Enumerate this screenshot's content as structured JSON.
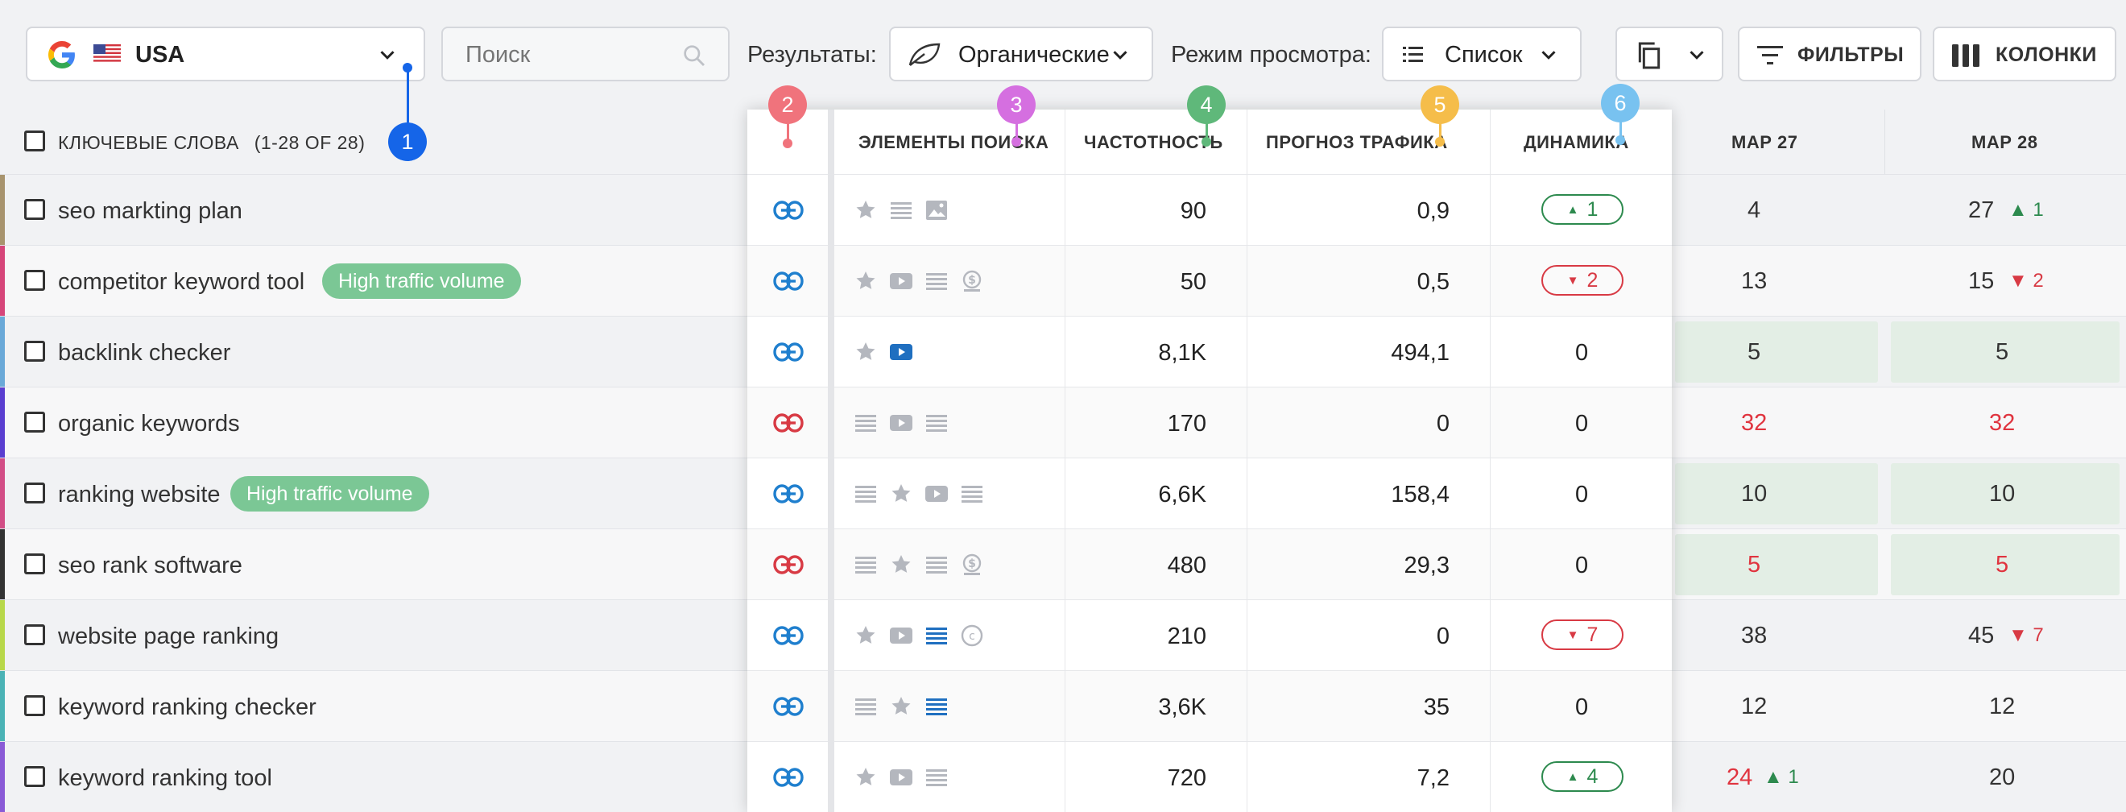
{
  "toolbar": {
    "country": "USA",
    "search_placeholder": "Поиск",
    "results_label": "Результаты:",
    "results_value": "Органические",
    "view_label": "Режим просмотра:",
    "view_value": "Список",
    "filters_label": "ФИЛЬТРЫ",
    "columns_label": "КОЛОНКИ"
  },
  "header": {
    "keywords_label": "КЛЮЧЕВЫЕ СЛОВА",
    "keywords_count": "(1-28 OF 28)",
    "serp_label": "ЭЛЕМЕНТЫ ПОИСКА",
    "freq_label": "ЧАСТОТНОСТЬ",
    "traffic_label": "ПРОГНОЗ ТРАФИКА",
    "dyn_label": "ДИНАМИКА",
    "date1": "МАР 27",
    "date2": "МАР 28"
  },
  "markers": [
    "1",
    "2",
    "3",
    "4",
    "5",
    "6"
  ],
  "colors": {
    "marker1": "#1565e8",
    "marker2": "#f0737c",
    "marker3": "#d56fe0",
    "marker4": "#5fb87a",
    "marker5": "#f5bd4a",
    "marker6": "#78c2f0",
    "link_blue": "#1f7fce",
    "link_red": "#d83a44",
    "badge": "#7bc795"
  },
  "rows": [
    {
      "keyword": "seo markting plan",
      "badge": "",
      "link": "blue",
      "freq": "90",
      "traffic": "0,9",
      "dyn": "1",
      "dyn_dir": "up",
      "d1": "4",
      "d1_delta": "",
      "d2": "27",
      "d2_delta": "1"
    },
    {
      "keyword": "competitor keyword tool",
      "badge": "High traffic volume",
      "link": "blue",
      "freq": "50",
      "traffic": "0,5",
      "dyn": "2",
      "dyn_dir": "down",
      "d1": "13",
      "d1_delta": "",
      "d2": "15",
      "d2_delta": "2"
    },
    {
      "keyword": "backlink checker",
      "badge": "",
      "link": "blue",
      "freq": "8,1K",
      "traffic": "494,1",
      "dyn": "0",
      "dyn_dir": "none",
      "d1": "5",
      "d1_delta": "",
      "d2": "5",
      "d2_delta": ""
    },
    {
      "keyword": "organic keywords",
      "badge": "",
      "link": "red",
      "freq": "170",
      "traffic": "0",
      "dyn": "0",
      "dyn_dir": "none",
      "d1": "32",
      "d1_delta": "",
      "d2": "32",
      "d2_delta": ""
    },
    {
      "keyword": "ranking website",
      "badge": "High traffic volume",
      "link": "blue",
      "freq": "6,6K",
      "traffic": "158,4",
      "dyn": "0",
      "dyn_dir": "none",
      "d1": "10",
      "d1_delta": "",
      "d2": "10",
      "d2_delta": ""
    },
    {
      "keyword": "seo rank software",
      "badge": "",
      "link": "red",
      "freq": "480",
      "traffic": "29,3",
      "dyn": "0",
      "dyn_dir": "none",
      "d1": "5",
      "d1_delta": "",
      "d2": "5",
      "d2_delta": ""
    },
    {
      "keyword": "website page ranking",
      "badge": "",
      "link": "blue",
      "freq": "210",
      "traffic": "0",
      "dyn": "7",
      "dyn_dir": "down",
      "d1": "38",
      "d1_delta": "",
      "d2": "45",
      "d2_delta": "7"
    },
    {
      "keyword": "keyword ranking checker",
      "badge": "",
      "link": "blue",
      "freq": "3,6K",
      "traffic": "35",
      "dyn": "0",
      "dyn_dir": "none",
      "d1": "12",
      "d1_delta": "",
      "d2": "12",
      "d2_delta": ""
    },
    {
      "keyword": "keyword ranking tool",
      "badge": "",
      "link": "blue",
      "freq": "720",
      "traffic": "7,2",
      "dyn": "4",
      "dyn_dir": "up",
      "d1": "24",
      "d1_delta": "1",
      "d2": "20",
      "d2_delta": ""
    }
  ]
}
